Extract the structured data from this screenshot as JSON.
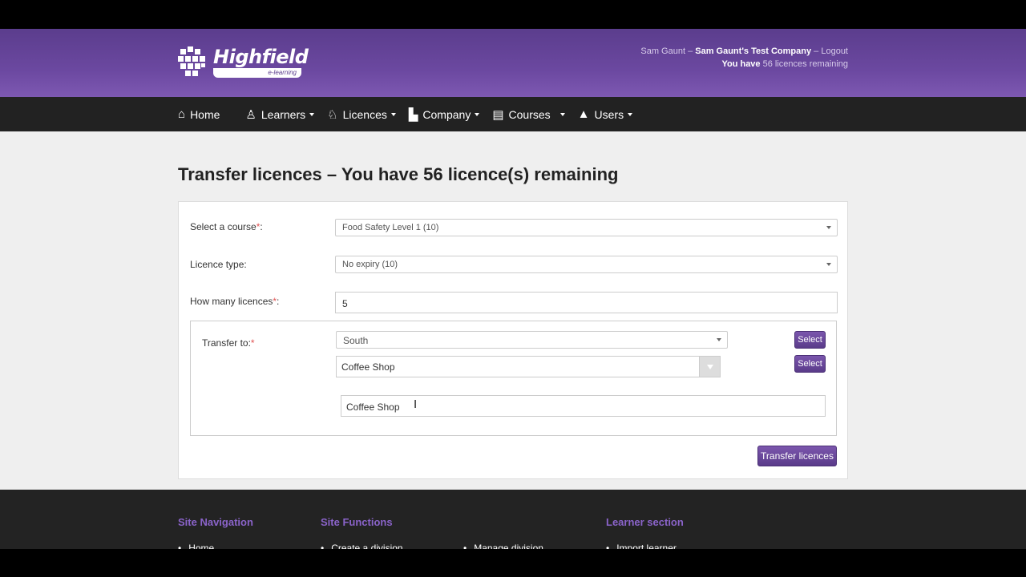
{
  "header": {
    "brand": {
      "name": "Highfield",
      "tagline": "e-learning"
    },
    "user": {
      "name": "Sam Gaunt",
      "sep1": "–",
      "company": "Sam Gaunt's Test Company",
      "sep2": "–",
      "logout": "Logout",
      "licences_prefix": "You have",
      "licences_suffix": "56 licences remaining"
    }
  },
  "nav": {
    "items": [
      {
        "label": "Home",
        "icon": "home-icon",
        "has_caret": false
      },
      {
        "label": "Learners",
        "icon": "learners-icon",
        "has_caret": true
      },
      {
        "label": "Licences",
        "icon": "licences-icon",
        "has_caret": true
      },
      {
        "label": "Company",
        "icon": "company-icon",
        "has_caret": true
      },
      {
        "label": "Courses",
        "icon": "book-icon",
        "has_caret": true
      },
      {
        "label": "Users",
        "icon": "graduation-cap-icon",
        "has_caret": true
      }
    ]
  },
  "page": {
    "title": "Transfer licences – You have 56 licence(s) remaining"
  },
  "form": {
    "course": {
      "label": "Select a course",
      "required_mark": "*",
      "colon": ":",
      "value": "Food Safety Level 1 (10)"
    },
    "licence_type": {
      "label": "Licence type:",
      "value": "No expiry (10)"
    },
    "how_many": {
      "label": "How many licences",
      "required_mark": "*",
      "colon": ":",
      "value": "5"
    },
    "transfer_to": {
      "label": "Transfer to:",
      "required_mark": "*",
      "region_value": "South",
      "site_value": "Coffee Shop",
      "filter_value": "Coffee Shop",
      "select_label_1": "Select",
      "select_label_2": "Select"
    },
    "submit_label": "Transfer licences"
  },
  "footer": {
    "headings": [
      "Site Navigation",
      "Site Functions",
      "Learner section"
    ],
    "links": [
      "Home",
      "Create a division",
      "Manage division",
      "Import learner"
    ]
  },
  "colors": {
    "header_purple": "#6b48a0",
    "nav_dark": "#222222",
    "button_purple": "#6a47a0",
    "footer_heading": "#8a63c9",
    "required_red": "#e05252"
  }
}
